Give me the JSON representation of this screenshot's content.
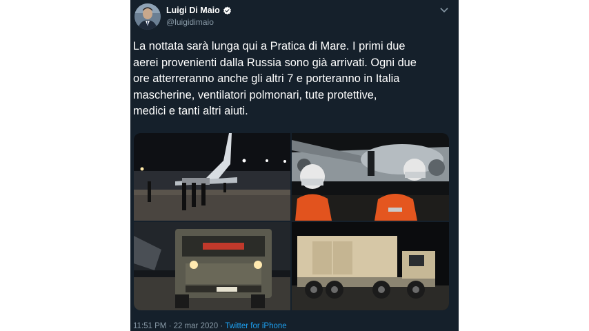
{
  "tweet": {
    "author_name": "Luigi Di Maio",
    "author_handle": "@luigidimaio",
    "verified_icon": "verified-badge-icon",
    "menu_icon": "chevron-down-icon",
    "text": "La nottata sarà lunga qui a Pratica di Mare. I primi due\naerei provenienti dalla Russia sono già arrivati. Ogni due\nore atterreranno anche gli altri 7 e porteranno in Italia\nmascherine, ventilatori polmonari, tute protettive,\nmedici e tanti altri aiuti.",
    "timestamp": "11:51 PM · 22 mar 2020",
    "separator": " · ",
    "source": "Twitter for iPhone"
  },
  "colors": {
    "background": "#15202b",
    "text": "#ffffff",
    "secondary": "#8899a6",
    "link": "#1da1f2",
    "verified": "#ffffff"
  }
}
